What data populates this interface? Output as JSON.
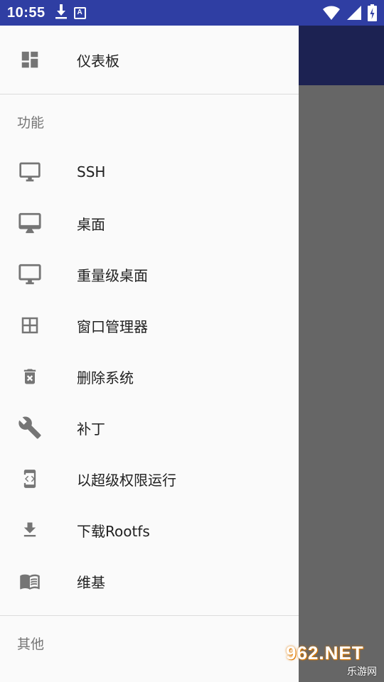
{
  "status_bar": {
    "time": "10:55",
    "icons": [
      "download-icon",
      "keyboard-a-icon",
      "wifi-icon",
      "cell-signal-icon",
      "battery-charging-icon"
    ],
    "keyboard_letter": "A"
  },
  "drawer": {
    "top_item": {
      "label": "仪表板",
      "icon": "dashboard-icon"
    },
    "sections": [
      {
        "header": "功能",
        "items": [
          {
            "label": "SSH",
            "icon": "monitor-icon"
          },
          {
            "label": "桌面",
            "icon": "desktop-icon"
          },
          {
            "label": "重量级桌面",
            "icon": "monitor-outline-icon"
          },
          {
            "label": "窗口管理器",
            "icon": "grid-window-icon"
          },
          {
            "label": "删除系统",
            "icon": "trash-icon"
          },
          {
            "label": "补丁",
            "icon": "wrench-icon"
          },
          {
            "label": "以超级权限运行",
            "icon": "code-device-icon"
          },
          {
            "label": "下载Rootfs",
            "icon": "download-icon"
          },
          {
            "label": "维基",
            "icon": "book-icon"
          }
        ]
      },
      {
        "header": "其他",
        "items": []
      }
    ]
  },
  "watermark": {
    "top": "962.NET",
    "bottom": "乐游网"
  },
  "colors": {
    "status_bar": "#2f3ea3",
    "toolbar_behind": "#1c2252",
    "scrim": "#666666",
    "drawer_bg": "#fafafa",
    "icon": "#757575",
    "text": "#212121"
  }
}
